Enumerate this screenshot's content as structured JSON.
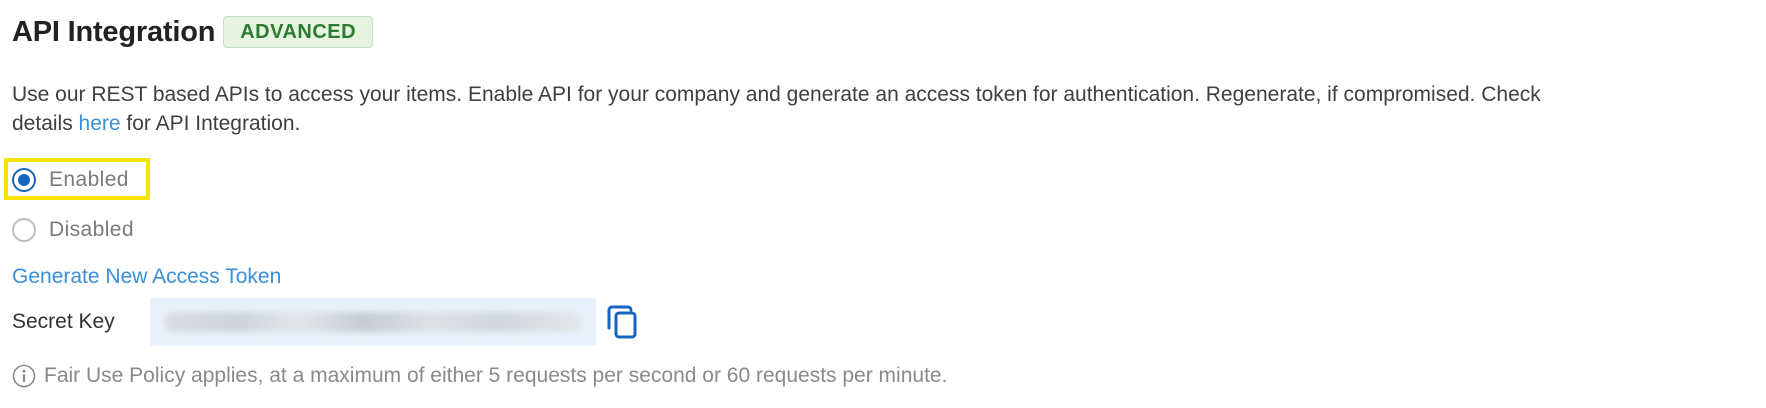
{
  "section": {
    "title": "API Integration",
    "badge": "ADVANCED",
    "description": {
      "line1": "Use our REST based APIs to access your items. Enable API for your company and generate an access token for authentication. Regenerate, if compromised. Check",
      "line2_prefix": "details ",
      "link_text": "here",
      "line2_suffix": " for API Integration."
    }
  },
  "api_status": {
    "options": [
      {
        "label": "Enabled",
        "selected": true
      },
      {
        "label": "Disabled",
        "selected": false
      }
    ]
  },
  "token": {
    "generate_link": "Generate New Access Token",
    "secret_key_label": "Secret Key",
    "secret_key_value": "",
    "copy_icon": "copy-icon"
  },
  "note": {
    "icon": "info-icon",
    "text": "Fair Use Policy applies, at a maximum of either 5 requests per second or 60 requests per minute."
  },
  "colors": {
    "accent": "#1565c0",
    "link": "#3a8fd6",
    "badge_bg": "#e4f4e1",
    "badge_text": "#2f7a32",
    "highlight": "#f3e500",
    "key_field_bg": "#e8f1fb"
  }
}
